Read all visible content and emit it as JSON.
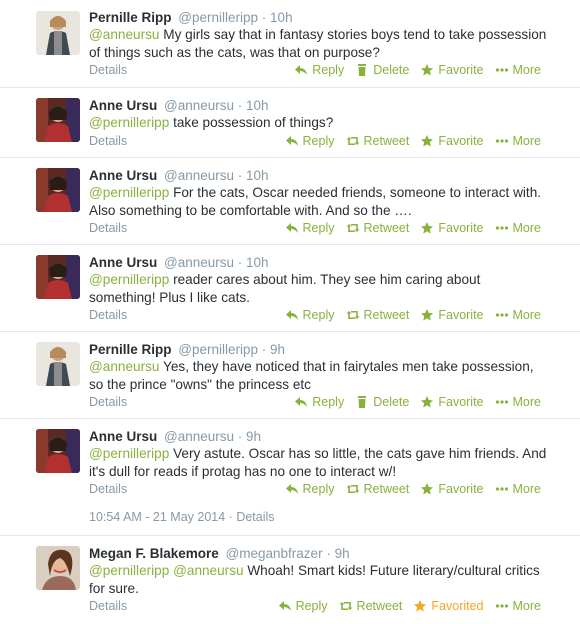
{
  "labels": {
    "details": "Details",
    "reply": "Reply",
    "retweet": "Retweet",
    "delete": "Delete",
    "favorite": "Favorite",
    "favorited": "Favorited",
    "more": "More"
  },
  "colors": {
    "accent": "#8ab13d",
    "muted": "#8899a6",
    "favorited": "#f5a623"
  },
  "timestamp_line": {
    "time": "10:54 AM - 21 May 2014",
    "sep": " · ",
    "details": "Details"
  },
  "tweets": [
    {
      "name": "Pernille Ripp",
      "handle": "@pernilleripp",
      "time": "10h",
      "mentions": [
        "@anneursu"
      ],
      "text": " My girls say that in fantasy stories boys tend to take possession of things such as the cats, was that on purpose?",
      "own": true
    },
    {
      "name": "Anne Ursu",
      "handle": "@anneursu",
      "time": "10h",
      "mentions": [
        "@pernilleripp"
      ],
      "text": " take possession of things?",
      "own": false
    },
    {
      "name": "Anne Ursu",
      "handle": "@anneursu",
      "time": "10h",
      "mentions": [
        "@pernilleripp"
      ],
      "text": " For the cats, Oscar needed friends, someone to interact with. Also something to be comfortable with. And so the ….",
      "own": false
    },
    {
      "name": "Anne Ursu",
      "handle": "@anneursu",
      "time": "10h",
      "mentions": [
        "@pernilleripp"
      ],
      "text": " reader cares about him. They see him caring about something! Plus I like cats.",
      "own": false
    },
    {
      "name": "Pernille Ripp",
      "handle": "@pernilleripp",
      "time": "9h",
      "mentions": [
        "@anneursu"
      ],
      "text": " Yes, they have noticed that in fairytales men take possession, so the prince \"owns\" the princess etc",
      "own": true
    },
    {
      "name": "Anne Ursu",
      "handle": "@anneursu",
      "time": "9h",
      "mentions": [
        "@pernilleripp"
      ],
      "text": " Very astute. Oscar has so little, the cats gave him friends. And it's dull for reads if protag has no one to interact w/!",
      "own": false
    },
    {
      "name": "Megan F. Blakemore",
      "handle": "@meganbfrazer",
      "time": "9h",
      "mentions": [
        "@pernilleripp",
        "@anneursu"
      ],
      "text": " Whoah! Smart kids! Future literary/cultural critics for sure.",
      "own": false,
      "favorited": true
    }
  ]
}
